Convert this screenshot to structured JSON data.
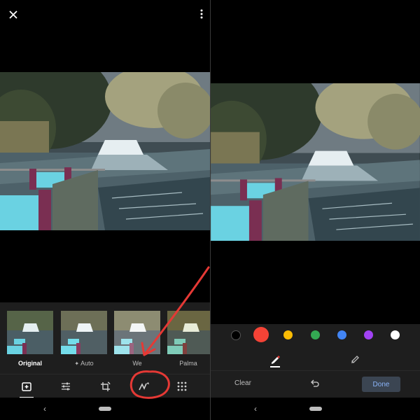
{
  "left_panel": {
    "close_icon": "close-icon",
    "more_icon": "more-vert-icon",
    "filters": [
      {
        "label": "Original",
        "active": true
      },
      {
        "label": "Auto",
        "icon": "sparkle-icon",
        "active": false
      },
      {
        "label": "We",
        "active": false
      },
      {
        "label": "Palma",
        "active": false
      }
    ],
    "tools": [
      {
        "name": "filters-tool",
        "icon": "filter-plus-icon",
        "active": true
      },
      {
        "name": "adjust-tool",
        "icon": "sliders-icon",
        "active": false
      },
      {
        "name": "crop-rotate-tool",
        "icon": "crop-rotate-icon",
        "active": false
      },
      {
        "name": "markup-tool",
        "icon": "markup-icon",
        "active": false
      },
      {
        "name": "more-tools",
        "icon": "grid-icon",
        "active": false
      }
    ]
  },
  "right_panel": {
    "colors": [
      "#000000",
      "#f44336",
      "#fbbc04",
      "#34a853",
      "#4285f4",
      "#a142f4",
      "#ffffff"
    ],
    "selected_color": "#f44336",
    "pens": [
      {
        "name": "pen",
        "icon": "pen-icon",
        "active": true
      },
      {
        "name": "highlighter",
        "icon": "highlighter-icon",
        "active": false
      }
    ],
    "clear_label": "Clear",
    "done_label": "Done",
    "undo_icon": "undo-icon"
  },
  "annotation_color": "#e53935"
}
